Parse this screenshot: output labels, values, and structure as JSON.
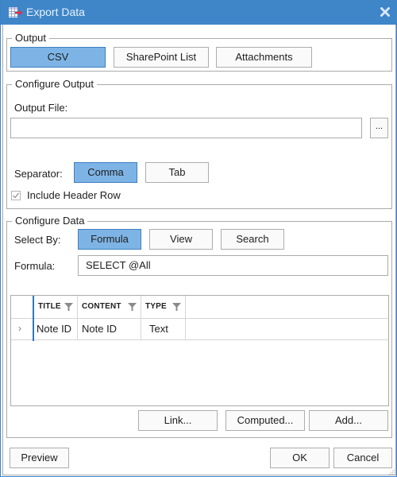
{
  "window": {
    "title": "Export Data",
    "icon": "table-export-icon",
    "close_icon": "close-icon",
    "accent_color": "#3f86c9"
  },
  "output": {
    "legend": "Output",
    "buttons": [
      {
        "label": "CSV",
        "active": true
      },
      {
        "label": "SharePoint List",
        "active": false
      },
      {
        "label": "Attachments",
        "active": false
      }
    ]
  },
  "configure_output": {
    "legend": "Configure Output",
    "output_file_label": "Output File:",
    "output_file_value": "",
    "browse_label": "...",
    "separator_label": "Separator:",
    "separator_options": [
      {
        "label": "Comma",
        "active": true
      },
      {
        "label": "Tab",
        "active": false
      }
    ],
    "include_header_label": "Include Header Row",
    "include_header_checked": true
  },
  "configure_data": {
    "legend": "Configure Data",
    "select_by_label": "Select By:",
    "select_by_options": [
      {
        "label": "Formula",
        "active": true
      },
      {
        "label": "View",
        "active": false
      },
      {
        "label": "Search",
        "active": false
      }
    ],
    "formula_label": "Formula:",
    "formula_value": "SELECT @All",
    "grid": {
      "columns": [
        "TITLE",
        "CONTENT",
        "TYPE"
      ],
      "rows": [
        {
          "title": "Note ID",
          "content": "Note ID",
          "type": "Text"
        }
      ]
    },
    "actions": {
      "link": "Link...",
      "computed": "Computed...",
      "add": "Add..."
    }
  },
  "footer": {
    "preview": "Preview",
    "ok": "OK",
    "cancel": "Cancel"
  },
  "colors": {
    "active_button": "#7eb4e5",
    "active_border": "#3d7fc0",
    "selection_line": "#2e78c4"
  }
}
